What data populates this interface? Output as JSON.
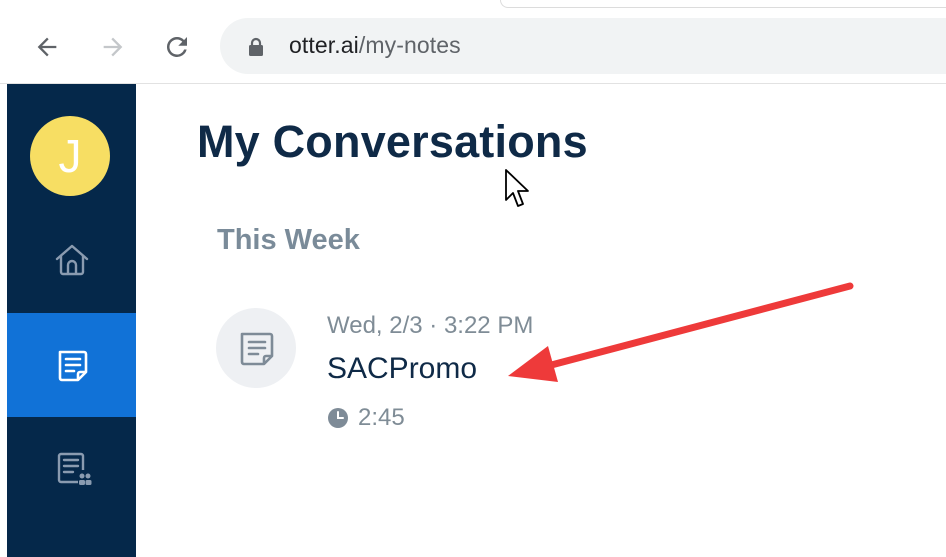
{
  "browser": {
    "url_host": "otter.ai",
    "url_path": "/my-notes",
    "icons": [
      "back-arrow-icon",
      "forward-arrow-icon",
      "reload-icon",
      "lock-icon"
    ]
  },
  "sidebar": {
    "avatar_initial": "J",
    "avatar_color": "#f7de63",
    "background": "#05284a",
    "active_color": "#1172d7",
    "items": [
      {
        "icon": "home-icon",
        "active": false
      },
      {
        "icon": "notes-icon",
        "active": true
      },
      {
        "icon": "shared-notes-icon",
        "active": false
      }
    ]
  },
  "main": {
    "title": "My Conversations",
    "section": "This Week",
    "conversations": [
      {
        "date": "Wed, 2/3 · 3:22 PM",
        "title": "SACPromo",
        "duration": "2:45",
        "icon": "transcript-icon"
      }
    ]
  },
  "annotation": {
    "arrow_color": "#ee3a3a"
  }
}
